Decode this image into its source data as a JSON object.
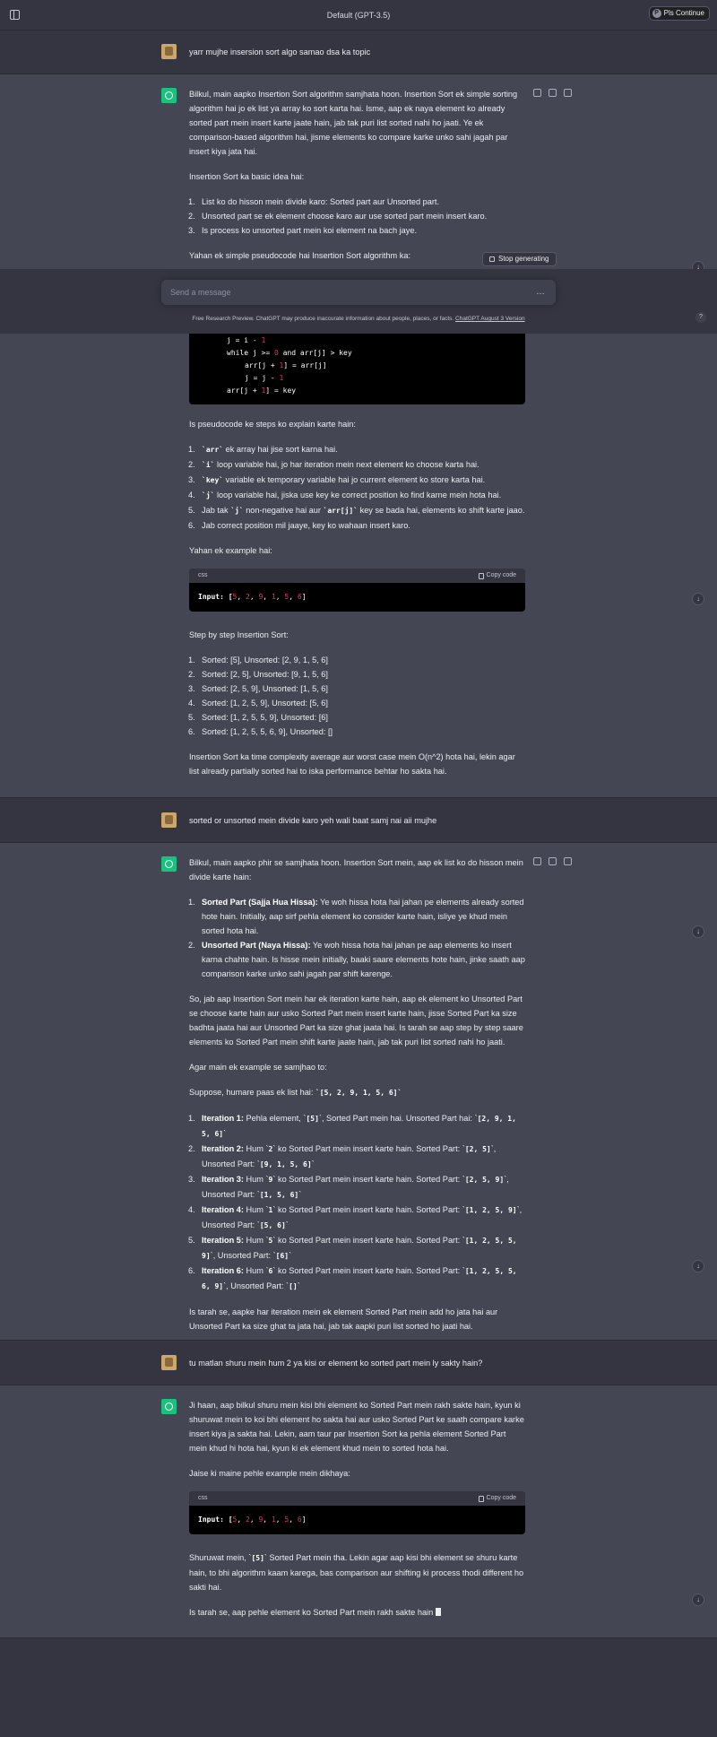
{
  "topbar": {
    "title": "Default (GPT-3.5)",
    "continue_label": "Pls Continue",
    "continue_icon_letter": "P"
  },
  "msg1_user": "yarr mujhe insersion sort algo samao dsa ka topic",
  "msg1_bot": {
    "intro": "Bilkul, main aapko Insertion Sort algorithm samjhata hoon. Insertion Sort ek simple sorting algorithm hai jo ek list ya array ko sort karta hai. Isme, aap ek naya element ko already sorted part mein insert karte jaate hain, jab tak puri list sorted nahi ho jaati. Ye ek comparison-based algorithm hai, jisme elements ko compare karke unko sahi jagah par insert kiya jata hai.",
    "basic_heading": "Insertion Sort ka basic idea hai:",
    "basic_steps": [
      "List ko do hisson mein divide karo: Sorted part aur Unsorted part.",
      "Unsorted part se ek element choose karo aur use sorted part mein insert karo.",
      "Is process ko unsorted part mein koi element na bach jaye."
    ],
    "pseudo_intro": "Yahan ek simple pseudocode hai Insertion Sort algorithm ka:",
    "pseudo_lines": [
      "j = i - ",
      "while j >= ",
      " and arr[j] > key",
      "arr[j + 1] = arr[j]",
      "j = j - ",
      "arr[j + 1] = key"
    ],
    "explain_heading": "Is pseudocode ke steps ko explain karte hain:",
    "explain_steps": [
      {
        "code": "`arr`",
        "text": " ek array hai jise sort karna hai."
      },
      {
        "code": "`i`",
        "text": " loop variable hai, jo har iteration mein next element ko choose karta hai."
      },
      {
        "code": "`key`",
        "text": " variable ek temporary variable hai jo current element ko store karta hai."
      },
      {
        "code": "`j`",
        "text": " loop variable hai, jiska use key ke correct position ko find karne mein hota hai."
      },
      {
        "pre": "Jab tak ",
        "code": "`j`",
        "mid": " non-negative hai aur ",
        "code2": "`arr[j]`",
        "text": " key se bada hai, elements ko shift karte jaao."
      },
      {
        "text": "Jab correct position mil jaaye, key ko wahaan insert karo."
      }
    ],
    "example_intro": "Yahan ek example hai:",
    "code_lang": "css",
    "copy_label": "Copy code",
    "example_code_prefix": "Input: [",
    "example_values": [
      "5",
      "2",
      "9",
      "1",
      "5",
      "6"
    ],
    "step_heading": "Step by step Insertion Sort:",
    "steps": [
      "Sorted: [5], Unsorted: [2, 9, 1, 5, 6]",
      "Sorted: [2, 5], Unsorted: [9, 1, 5, 6]",
      "Sorted: [2, 5, 9], Unsorted: [1, 5, 6]",
      "Sorted: [1, 2, 5, 9], Unsorted: [5, 6]",
      "Sorted: [1, 2, 5, 5, 9], Unsorted: [6]",
      "Sorted: [1, 2, 5, 5, 6, 9], Unsorted: []"
    ],
    "complexity": "Insertion Sort ka time complexity average aur worst case mein O(n^2) hota hai, lekin agar list already partially sorted hai to iska performance behtar ho sakta hai."
  },
  "msg2_user": "sorted or unsorted mein divide karo yeh wali baat samj nai aii mujhe",
  "msg2_bot": {
    "intro": "Bilkul, main aapko phir se samjhata hoon. Insertion Sort mein, aap ek list ko do hisson mein divide karte hain:",
    "parts": [
      {
        "title": "Sorted Part (Sajja Hua Hissa):",
        "text": " Ye woh hissa hota hai jahan pe elements already sorted hote hain. Initially, aap sirf pehla element ko consider karte hain, isliye ye khud mein sorted hota hai."
      },
      {
        "title": "Unsorted Part (Naya Hissa):",
        "text": " Ye woh hissa hota hai jahan pe aap elements ko insert karna chahte hain. Is hisse mein initially, baaki saare elements hote hain, jinke saath aap comparison karke unko sahi jagah par shift karenge."
      }
    ],
    "para": "So, jab aap Insertion Sort mein har ek iteration karte hain, aap ek element ko Unsorted Part se choose karte hain aur usko Sorted Part mein insert karte hain, jisse Sorted Part ka size badhta jaata hai aur Unsorted Part ka size ghat jaata hai. Is tarah se aap step by step saare elements ko Sorted Part mein shift karte jaate hain, jab tak puri list sorted nahi ho jaati.",
    "example_intro": "Agar main ek example se samjhao to:",
    "suppose_pre": "Suppose, humare paas ek list hai: ",
    "suppose_code": "`[5, 2, 9, 1, 5, 6]`",
    "iterations": [
      "<b>Iteration 1:</b> Pehla element, `<code>[5]</code>`, Sorted Part mein hai. Unsorted Part hai: `<code>[2, 9, 1, 5, 6]</code>`",
      "<b>Iteration 2:</b> Hum `<code>2</code>` ko Sorted Part mein insert karte hain. Sorted Part: `<code>[2, 5]</code>`, Unsorted Part: `<code>[9, 1, 5, 6]</code>`",
      "<b>Iteration 3:</b> Hum `<code>9</code>` ko Sorted Part mein insert karte hain. Sorted Part: `<code>[2, 5, 9]</code>`, Unsorted Part: `<code>[1, 5, 6]</code>`",
      "<b>Iteration 4:</b> Hum `<code>1</code>` ko Sorted Part mein insert karte hain. Sorted Part: `<code>[1, 2, 5, 9]</code>`, Unsorted Part: `<code>[5, 6]</code>`",
      "<b>Iteration 5:</b> Hum `<code>5</code>` ko Sorted Part mein insert karte hain. Sorted Part: `<code>[1, 2, 5, 5, 9]</code>`, Unsorted Part: `<code>[6]</code>`",
      "<b>Iteration 6:</b> Hum `<code>6</code>` ko Sorted Part mein insert karte hain. Sorted Part: `<code>[1, 2, 5, 5, 6, 9]</code>`, Unsorted Part: `<code>[]</code>`"
    ],
    "closing": "Is tarah se, aapke har iteration mein ek element Sorted Part mein add ho jata hai aur Unsorted Part ka size ghat ta jata hai, jab tak aapki puri list sorted ho jaati hai."
  },
  "msg3_user": "tu matlan shuru mein hum 2 ya kisi or element ko sorted part mein ly sakty hain?",
  "msg3_bot": {
    "intro": "Ji haan, aap bilkul shuru mein kisi bhi element ko Sorted Part mein rakh sakte hain, kyun ki shuruwat mein to koi bhi element ho sakta hai aur usko Sorted Part ke saath compare karke insert kiya ja sakta hai. Lekin, aam taur par Insertion Sort ka pehla element Sorted Part mein khud hi hota hai, kyun ki ek element khud mein to sorted hota hai.",
    "example_intro": "Jaise ki maine pehle example mein dikhaya:",
    "para_pre": "Shuruwat mein, `",
    "para_code": "[5]",
    "para_post": "` Sorted Part mein tha. Lekin agar aap kisi bhi element se shuru karte hain, to bhi algorithm kaam karega, bas comparison aur shifting ki process thodi different ho sakti hai.",
    "final": "Is tarah se, aap pehle element ko Sorted Part mein rakh sakte hain"
  },
  "input": {
    "placeholder": "Send a message"
  },
  "stop_label": "Stop generating",
  "footer": {
    "text": "Free Research Preview. ChatGPT may produce inaccurate information about people, places, or facts. ",
    "link": "ChatGPT August 3 Version"
  },
  "help_label": "?",
  "colors": {
    "bg": "#343541",
    "bot_bg": "#444654",
    "accent": "#19c37d",
    "number": "#df3079"
  }
}
